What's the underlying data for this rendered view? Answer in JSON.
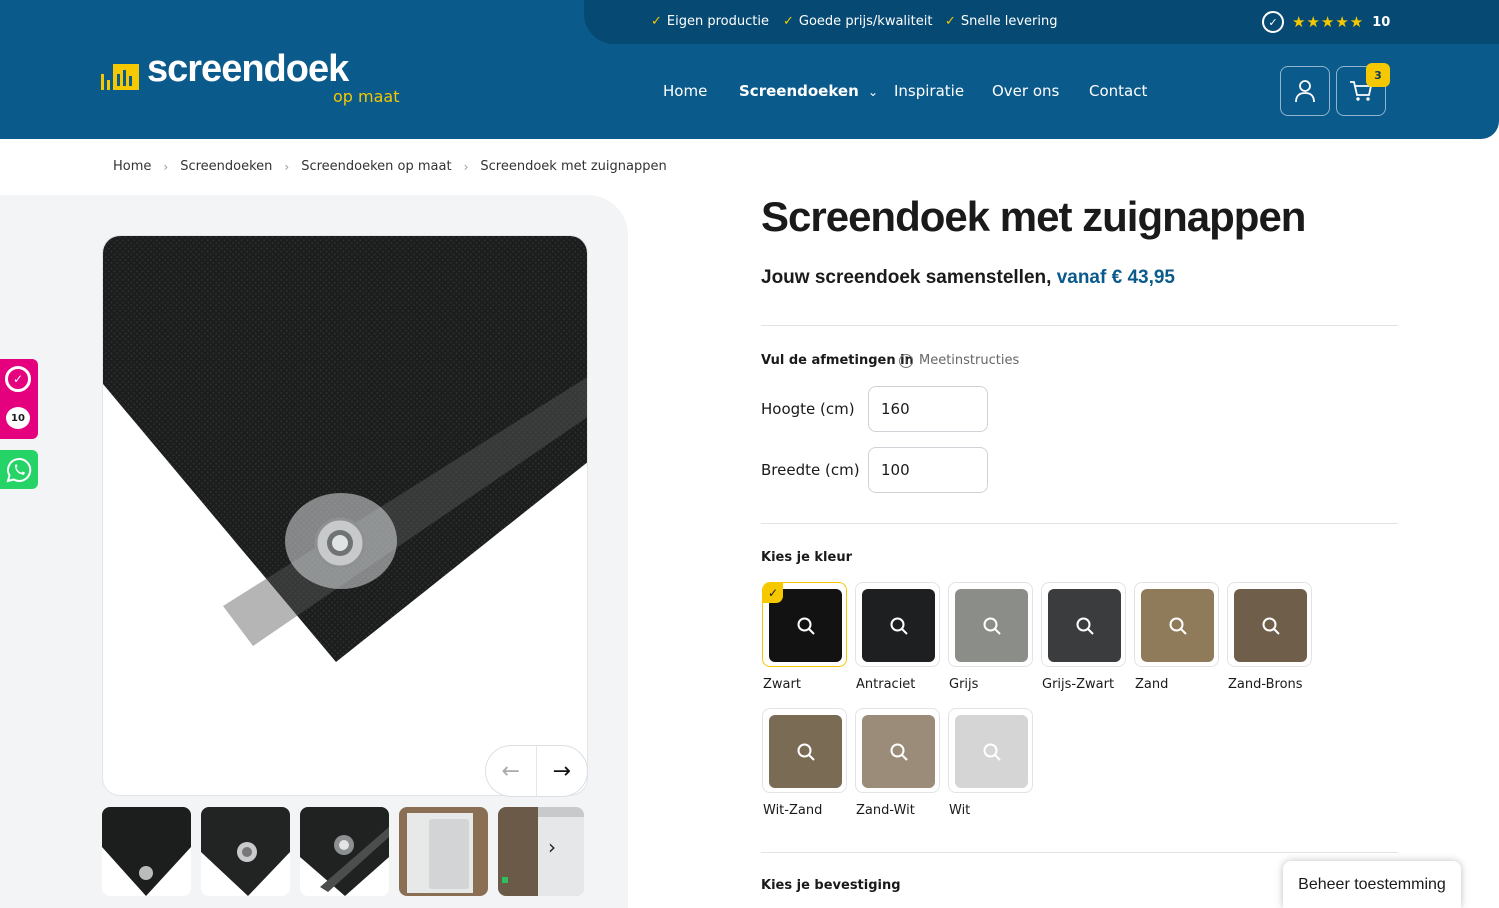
{
  "topbar": {
    "usps": [
      "Eigen productie",
      "Goede prijs/kwaliteit",
      "Snelle levering"
    ],
    "rating_stars": "★★★★★",
    "rating_score": "10"
  },
  "logo": {
    "main": "screendoek",
    "sub": "op maat"
  },
  "nav": {
    "home": "Home",
    "screendoeken": "Screendoeken",
    "inspiratie": "Inspiratie",
    "over_ons": "Over ons",
    "contact": "Contact"
  },
  "cart": {
    "count": "3"
  },
  "breadcrumb": [
    "Home",
    "Screendoeken",
    "Screendoeken op maat",
    "Screendoek met zuignappen"
  ],
  "side": {
    "kiyoh_score": "10"
  },
  "product": {
    "title": "Screendoek met zuignappen",
    "subtitle": "Jouw screendoek samenstellen,",
    "price": "vanaf € 43,95"
  },
  "dimensions": {
    "label": "Vul de afmetingen in",
    "measure_link": "Meetinstructies",
    "height_label": "Hoogte (cm)",
    "height_value": "160",
    "width_label": "Breedte (cm)",
    "width_value": "100"
  },
  "colors": {
    "label": "Kies je kleur",
    "items": [
      {
        "name": "Zwart",
        "color": "#121212",
        "selected": true
      },
      {
        "name": "Antraciet",
        "color": "#1e1f20",
        "selected": false
      },
      {
        "name": "Grijs",
        "color": "#8a8d88",
        "selected": false
      },
      {
        "name": "Grijs-Zwart",
        "color": "#3b3c3d",
        "selected": false
      },
      {
        "name": "Zand",
        "color": "#8f7a5a",
        "selected": false
      },
      {
        "name": "Zand-Brons",
        "color": "#6f5e4a",
        "selected": false
      },
      {
        "name": "Wit-Zand",
        "color": "#7a6b55",
        "selected": false
      },
      {
        "name": "Zand-Wit",
        "color": "#9a8c78",
        "selected": false
      },
      {
        "name": "Wit",
        "color": "#d4d5d4",
        "selected": false
      }
    ]
  },
  "mounting": {
    "label": "Kies je bevestiging"
  },
  "consent": {
    "label": "Beheer toestemming"
  }
}
